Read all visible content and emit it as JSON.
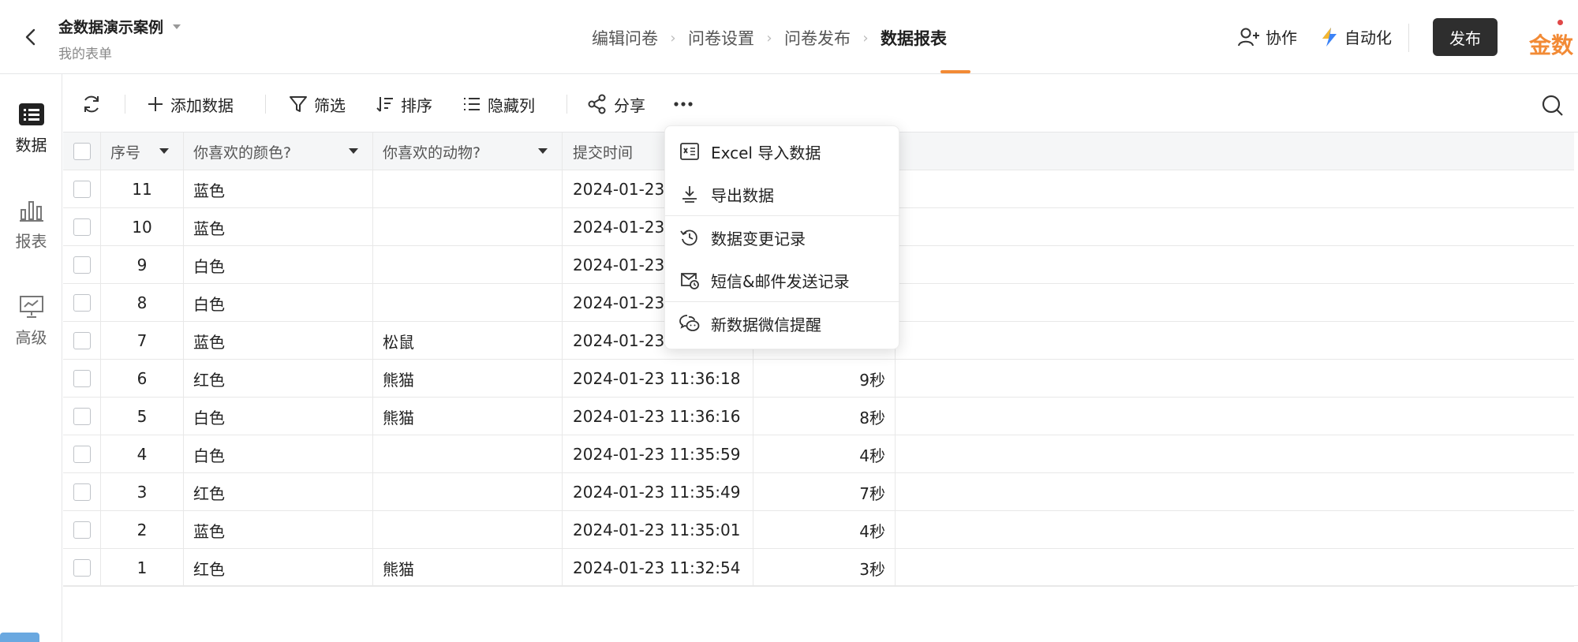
{
  "header": {
    "title": "金数据演示案例",
    "subtitle": "我的表单",
    "steps": [
      "编辑问卷",
      "问卷设置",
      "问卷发布",
      "数据报表"
    ],
    "collab_label": "协作",
    "auto_label": "自动化",
    "publish_label": "发布",
    "brand": "金数",
    "accent_color": "#f28a35"
  },
  "rail": {
    "items": [
      {
        "label": "数据",
        "icon": "list-icon"
      },
      {
        "label": "报表",
        "icon": "bar-chart-icon"
      },
      {
        "label": "高级",
        "icon": "presentation-icon"
      }
    ]
  },
  "toolbar": {
    "add_label": "添加数据",
    "filter_label": "筛选",
    "sort_label": "排序",
    "hide_label": "隐藏列",
    "share_label": "分享"
  },
  "table": {
    "headers": [
      "序号",
      "你喜欢的颜色?",
      "你喜欢的动物?",
      "提交时间"
    ],
    "rows": [
      {
        "seq": "11",
        "color": "蓝色",
        "animal": "",
        "time": "2024-01-23",
        "dur": ""
      },
      {
        "seq": "10",
        "color": "蓝色",
        "animal": "",
        "time": "2024-01-23",
        "dur": ""
      },
      {
        "seq": "9",
        "color": "白色",
        "animal": "",
        "time": "2024-01-23",
        "dur": ""
      },
      {
        "seq": "8",
        "color": "白色",
        "animal": "",
        "time": "2024-01-23",
        "dur": ""
      },
      {
        "seq": "7",
        "color": "蓝色",
        "animal": "松鼠",
        "time": "2024-01-23",
        "dur": ""
      },
      {
        "seq": "6",
        "color": "红色",
        "animal": "熊猫",
        "time": "2024-01-23 11:36:18",
        "dur": "9秒"
      },
      {
        "seq": "5",
        "color": "白色",
        "animal": "熊猫",
        "time": "2024-01-23 11:36:16",
        "dur": "8秒"
      },
      {
        "seq": "4",
        "color": "白色",
        "animal": "",
        "time": "2024-01-23 11:35:59",
        "dur": "4秒"
      },
      {
        "seq": "3",
        "color": "红色",
        "animal": "",
        "time": "2024-01-23 11:35:49",
        "dur": "7秒"
      },
      {
        "seq": "2",
        "color": "蓝色",
        "animal": "",
        "time": "2024-01-23 11:35:01",
        "dur": "4秒"
      },
      {
        "seq": "1",
        "color": "红色",
        "animal": "熊猫",
        "time": "2024-01-23 11:32:54",
        "dur": "3秒"
      }
    ]
  },
  "menu": {
    "items": [
      {
        "label": "Excel 导入数据",
        "icon": "excel-icon"
      },
      {
        "label": "导出数据",
        "icon": "download-icon"
      },
      {
        "label": "数据变更记录",
        "icon": "history-icon"
      },
      {
        "label": "短信&邮件发送记录",
        "icon": "mail-clock-icon"
      },
      {
        "label": "新数据微信提醒",
        "icon": "wechat-icon"
      }
    ]
  }
}
